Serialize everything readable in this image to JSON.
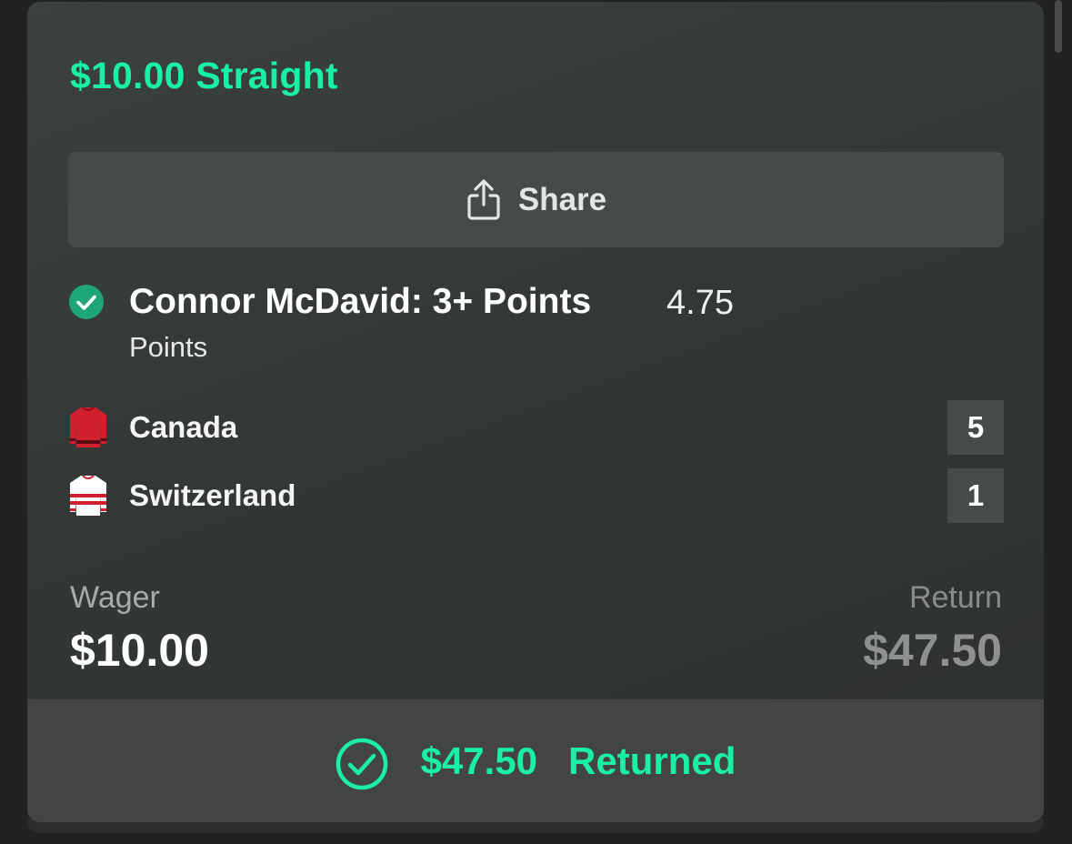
{
  "bet": {
    "title": "$10.00 Straight"
  },
  "share": {
    "label": "Share",
    "icon": "share-icon"
  },
  "selection": {
    "status_icon": "check-circle-icon",
    "name": "Connor McDavid: 3+ Points",
    "odds": "4.75",
    "market": "Points"
  },
  "teams": [
    {
      "name": "Canada",
      "score": "5",
      "jersey_icon": "jersey-red-icon",
      "jersey_color": "#d0202e"
    },
    {
      "name": "Switzerland",
      "score": "1",
      "jersey_icon": "jersey-white-red-stripes-icon",
      "jersey_color": "#ffffff"
    }
  ],
  "wager": {
    "label": "Wager",
    "value": "$10.00"
  },
  "return": {
    "label": "Return",
    "value": "$47.50"
  },
  "result": {
    "amount": "$47.50",
    "status": "Returned",
    "icon": "check-circle-outline-icon"
  },
  "colors": {
    "accent": "#19f0a4",
    "win_check": "#1fa678",
    "card_background": "#363a39",
    "button_background": "#454b49",
    "footer_background": "#434545"
  }
}
